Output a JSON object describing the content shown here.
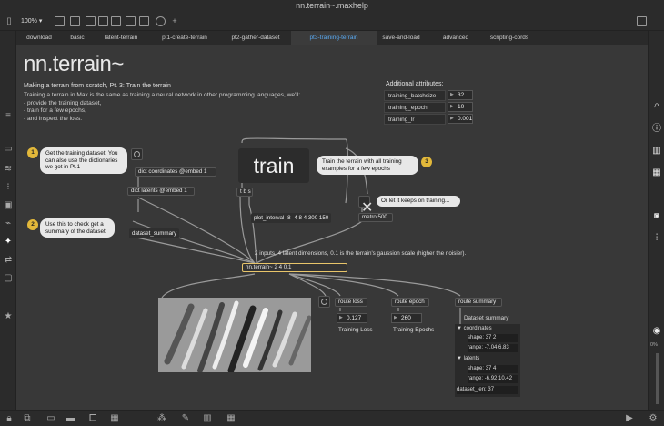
{
  "window": {
    "title": "nn.terrain~.maxhelp"
  },
  "toolbar": {
    "zoom": "100%"
  },
  "tabs": [
    {
      "label": "download"
    },
    {
      "label": "basic"
    },
    {
      "label": "latent-terrain"
    },
    {
      "label": "pt1-create-terrain"
    },
    {
      "label": "pt2-gather-dataset"
    },
    {
      "label": "pt3-training-terrain"
    },
    {
      "label": "save-and-load"
    },
    {
      "label": "advanced"
    },
    {
      "label": "scripting-cords"
    }
  ],
  "header": {
    "title": "nn.terrain~",
    "subtitle": "Making a terrain from scratch, Pt. 3: Train the terrain",
    "intro": [
      "Training a terrain in Max is the same as training a neural network in other programming languages, we'll:",
      "- provide the training dataset,",
      "- train for a few epochs,",
      "- and inspect the loss."
    ]
  },
  "attributes": {
    "heading": "Additional attributes:",
    "rows": [
      {
        "name": "training_batchsize",
        "value": "32"
      },
      {
        "name": "training_epoch",
        "value": "10"
      },
      {
        "name": "training_lr",
        "value": "0.001"
      }
    ]
  },
  "steps": {
    "one": "1",
    "two": "2",
    "three": "3",
    "one_text": "Get the training dataset. You can also use the dictionaries we got in Pt.1",
    "two_text": "Use this to check get a summary of the dataset",
    "three_text": "Train the terrain with all training examples for a few epochs"
  },
  "objects": {
    "dict_coords": "dict coordinates @embed 1",
    "dict_latents": "dict latents @embed 1",
    "dataset_summary": "dataset_summary",
    "train": "train",
    "tbs": "t b s",
    "plot_interval": "plot_interval -8 -4 8 4 300 150",
    "metro_hint": "Or let it keeps on training...",
    "metro": "metro 500",
    "nn_comment": "2 inputs, 4 latent dimensions, 0.1 is the terrain's gaussion scale (higher the noisier).",
    "nn_terrain": "nn.terrain~ 2 4 0.1",
    "route_loss": "route loss",
    "route_epoch": "route epoch",
    "route_summary": "route summary",
    "loss_value": "0.127",
    "epoch_value": "260",
    "loss_label": "Training Loss",
    "epoch_label": "Training Epochs",
    "summary_label": "Dataset summary"
  },
  "summary": {
    "coordinates": "coordinates",
    "coord_shape_label": "shape:",
    "coord_shape": "37 2",
    "coord_range_label": "range:",
    "coord_range": "-7.04 6.83",
    "latents": "latents",
    "lat_shape_label": "shape:",
    "lat_shape": "37 4",
    "lat_range_label": "range:",
    "lat_range": "-6.92 10.42",
    "dataset_len_label": "dataset_len:",
    "dataset_len": "37"
  },
  "rightbar": {
    "zoom_pct": "0%"
  }
}
